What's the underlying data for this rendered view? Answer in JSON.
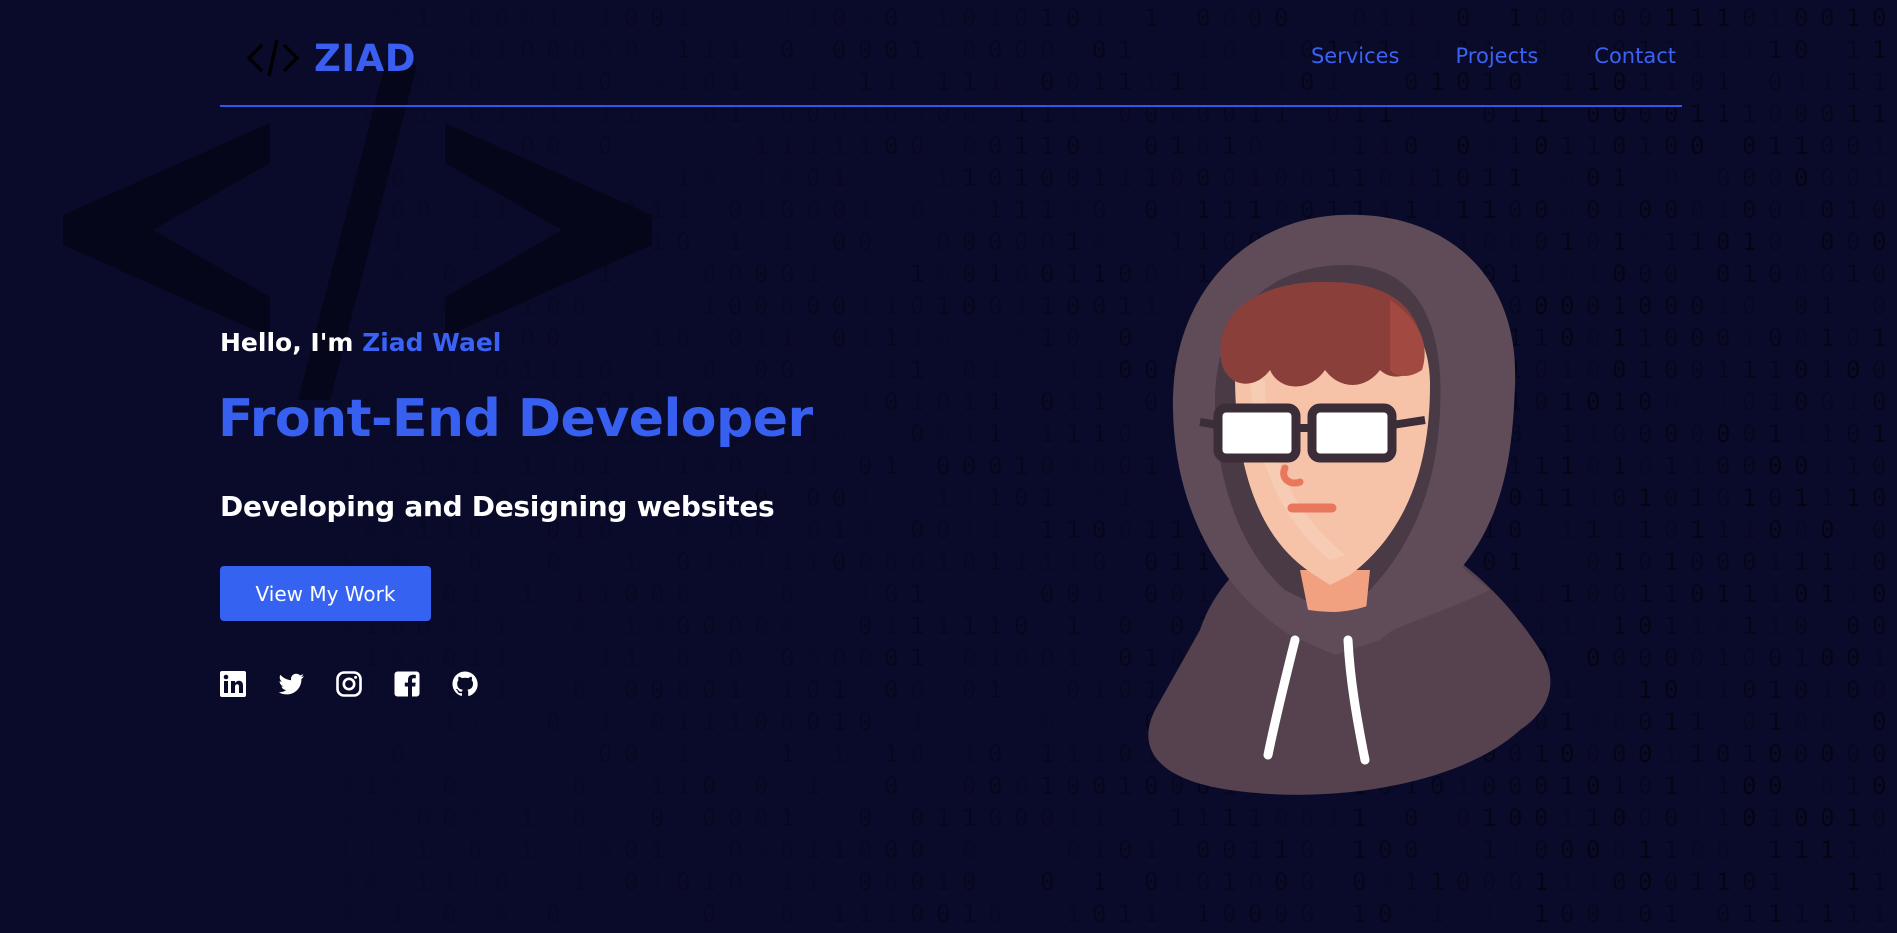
{
  "header": {
    "logo_text": "ZIAD",
    "logo_icon": "code-icon",
    "nav": [
      {
        "label": "Services"
      },
      {
        "label": "Projects"
      },
      {
        "label": "Contact"
      }
    ]
  },
  "hero": {
    "greeting_prefix": "Hello, I'm ",
    "greeting_name": "Ziad Wael",
    "role": "Front-End Developer",
    "tagline": "Developing and Designing websites",
    "cta_label": "View My Work"
  },
  "socials": [
    {
      "icon": "linkedin-icon"
    },
    {
      "icon": "twitter-icon"
    },
    {
      "icon": "instagram-icon"
    },
    {
      "icon": "facebook-icon"
    },
    {
      "icon": "github-icon"
    }
  ],
  "colors": {
    "background": "#0a0b2a",
    "accent": "#3562f0",
    "text": "#ffffff"
  }
}
